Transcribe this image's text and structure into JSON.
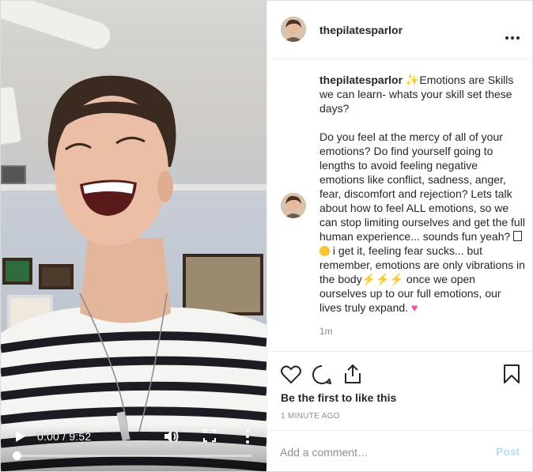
{
  "post": {
    "username": "thepilatesparlor",
    "caption_intro": "Emotions are Skills we can learn- whats your skill set these days?",
    "caption_body_1": "Do you feel at the mercy of all of your emotions? Do find yourself going to lengths to avoid feeling negative emotions like conflict, sadness, anger, fear, discomfort and rejection? Lets talk about how to feel ALL emotions, so we can stop limiting ourselves and get the full human experience... sounds fun yeah?",
    "caption_body_2": " i get it, feeling fear sucks... but remember, emotions are only vibrations in the body",
    "caption_body_3": " once we open ourselves up to our full emotions, our lives truly expand. ",
    "caption_time": "1m",
    "likes_text": "Be the first to like this",
    "timestamp": "1 MINUTE AGO"
  },
  "video": {
    "current_time": "0:00",
    "duration": "9:52",
    "time_display": "0:00 / 9:52",
    "progress": 0
  },
  "comment": {
    "placeholder": "Add a comment…",
    "post_label": "Post"
  },
  "icons": {
    "sparkle": "sparkles-emoji",
    "bolt": "high-voltage-emoji",
    "heart": "pink-heart-emoji"
  },
  "colors": {
    "post_button_disabled": "#b2dffc",
    "muted_text": "#8e8e8e"
  }
}
